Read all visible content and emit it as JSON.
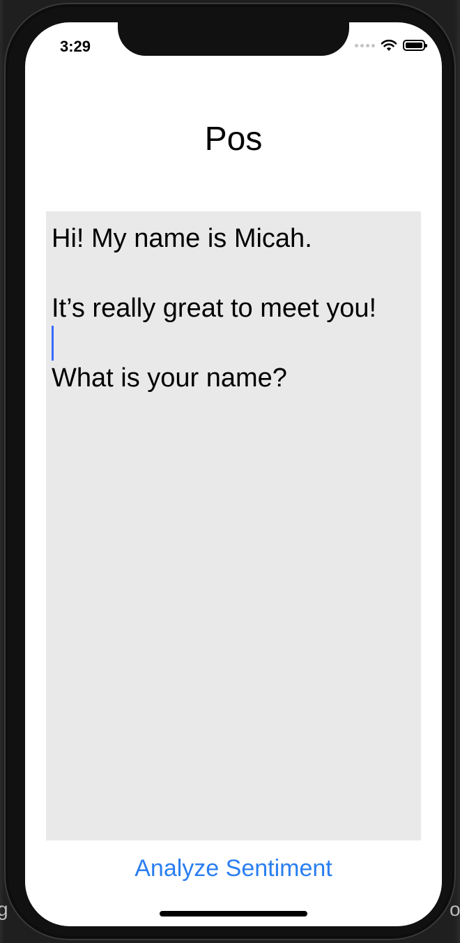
{
  "status_bar": {
    "time": "3:29",
    "battery_level_percent": 100,
    "icons": [
      "signal-dots-icon",
      "wifi-icon",
      "battery-icon"
    ]
  },
  "screen": {
    "title": "Pos",
    "text_view": {
      "lines": [
        "Hi! My name is Micah.",
        "",
        "It’s really great to meet you!",
        "",
        "What is your name?"
      ],
      "background_color": "#e9e9e9",
      "caret_color": "#3a6bff"
    },
    "analyze_button_label": "Analyze Sentiment",
    "accent_color": "#2a7ef0"
  },
  "desktop": {
    "left_edge_glyph": "g",
    "right_edge_glyph": "o"
  }
}
